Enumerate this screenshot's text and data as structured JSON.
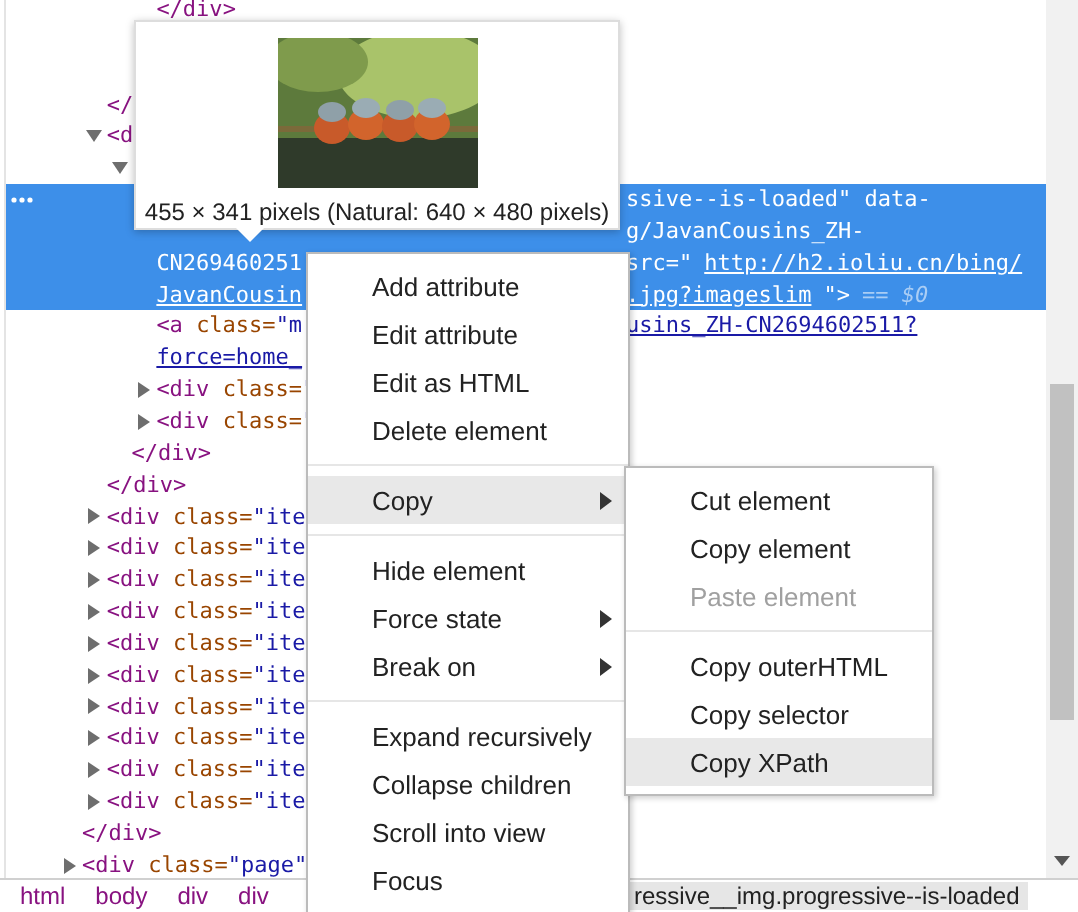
{
  "tree": [
    {
      "children": [
        {
          "children": [
            {
              "children": [
                {
                  "selected": false,
                  "rows": [
                    {
                      "text": [
                        {
                          "kind": "code",
                          "text": "</div>"
                        }
                      ]
                    }
                  ]
                }
              ]
            }
          ]
        },
        {
          "selected": false,
          "rows": [
            {
              "text": [
                {
                  "kind": "code",
                  "text": "</"
                }
              ]
            }
          ]
        },
        {
          "selected": false,
          "expanded": true,
          "rows": [
            {
              "text": [
                {
                  "kind": "code",
                  "text": "<d"
                }
              ]
            }
          ],
          "children": [
            {
              "selected": false,
              "expanded": true,
              "children": [
                {
                  "selected": true,
                  "rows": [
                    {
                      "tail": [
                        {
                          "kind": "code",
                          "text": "ssive--is-loaded\" data-"
                        }
                      ]
                    },
                    {
                      "tail": [
                        {
                          "kind": "code",
                          "text": "g/JavanCousins_ZH-"
                        }
                      ]
                    },
                    {
                      "text": [
                        {
                          "kind": "code",
                          "text": "CN269460251"
                        }
                      ],
                      "tail": [
                        {
                          "kind": "code",
                          "text": "src=\""
                        },
                        {
                          "kind": "link",
                          "text": "http://h2.ioliu.cn/bing/"
                        }
                      ]
                    },
                    {
                      "text": [
                        {
                          "kind": "link",
                          "text": "JavanCousin"
                        }
                      ],
                      "tail": [
                        {
                          "kind": "link",
                          "text": ".jpg?imageslim"
                        },
                        {
                          "kind": "code",
                          "text": "\">"
                        },
                        {
                          "kind": "muted",
                          "text": "== $0"
                        }
                      ]
                    }
                  ]
                },
                {
                  "selected": false,
                  "rows": [
                    {
                      "text": [
                        {
                          "kind": "code",
                          "text": "<a class=\"m"
                        }
                      ],
                      "tail": [
                        {
                          "kind": "link",
                          "text": "usins_ZH-CN2694602511?"
                        }
                      ]
                    },
                    {
                      "text": [
                        {
                          "kind": "link",
                          "text": "force=home_"
                        }
                      ]
                    }
                  ]
                },
                {
                  "selected": false,
                  "expanded": false,
                  "rows": [
                    {
                      "text": [
                        {
                          "kind": "code",
                          "text": "<div class=\""
                        }
                      ]
                    }
                  ]
                },
                {
                  "selected": false,
                  "expanded": false,
                  "rows": [
                    {
                      "text": [
                        {
                          "kind": "code",
                          "text": "<div class=\""
                        }
                      ]
                    }
                  ]
                }
              ]
            },
            {
              "selected": false,
              "rows": [
                {
                  "text": [
                    {
                      "kind": "code",
                      "text": "</div>"
                    }
                  ]
                }
              ]
            }
          ]
        },
        {
          "selected": false,
          "rows": [
            {
              "text": [
                {
                  "kind": "code",
                  "text": "</div>"
                }
              ]
            }
          ]
        },
        {
          "selected": false,
          "expanded": false,
          "rows": [
            {
              "text": [
                {
                  "kind": "code",
                  "text": "<div class=\"ite"
                }
              ]
            }
          ]
        },
        {
          "selected": false,
          "expanded": false,
          "rows": [
            {
              "text": [
                {
                  "kind": "code",
                  "text": "<div class=\"ite"
                }
              ]
            }
          ]
        },
        {
          "selected": false,
          "expanded": false,
          "rows": [
            {
              "text": [
                {
                  "kind": "code",
                  "text": "<div class=\"ite"
                }
              ]
            }
          ]
        },
        {
          "selected": false,
          "expanded": false,
          "rows": [
            {
              "text": [
                {
                  "kind": "code",
                  "text": "<div class=\"ite"
                }
              ]
            }
          ]
        },
        {
          "selected": false,
          "expanded": false,
          "rows": [
            {
              "text": [
                {
                  "kind": "code",
                  "text": "<div class=\"ite"
                }
              ]
            }
          ]
        },
        {
          "selected": false,
          "expanded": false,
          "rows": [
            {
              "text": [
                {
                  "kind": "code",
                  "text": "<div class=\"ite"
                }
              ]
            }
          ]
        },
        {
          "selected": false,
          "expanded": false,
          "rows": [
            {
              "text": [
                {
                  "kind": "code",
                  "text": "<div class=\"ite"
                }
              ]
            }
          ]
        },
        {
          "selected": false,
          "expanded": false,
          "rows": [
            {
              "text": [
                {
                  "kind": "code",
                  "text": "<div class=\"ite"
                }
              ]
            }
          ]
        },
        {
          "selected": false,
          "expanded": false,
          "rows": [
            {
              "text": [
                {
                  "kind": "code",
                  "text": "<div class=\"ite"
                }
              ]
            }
          ]
        },
        {
          "selected": false,
          "expanded": false,
          "rows": [
            {
              "text": [
                {
                  "kind": "code",
                  "text": "<div class=\"ite"
                }
              ]
            }
          ]
        }
      ]
    },
    {
      "selected": false,
      "rows": [
        {
          "text": [
            {
              "kind": "code",
              "text": "</div>"
            }
          ]
        }
      ]
    },
    {
      "selected": false,
      "expanded": false,
      "rows": [
        {
          "text": [
            {
              "kind": "code",
              "text": "<div class=\"page\""
            }
          ]
        }
      ]
    }
  ],
  "image_tooltip": {
    "caption": "455 × 341 pixels (Natural: 640 × 480 pixels)"
  },
  "context_menu": {
    "items": [
      {
        "kind": "item",
        "label": "Add attribute",
        "selected": false
      },
      {
        "kind": "item",
        "label": "Edit attribute",
        "selected": false
      },
      {
        "kind": "item",
        "label": "Edit as HTML",
        "selected": false
      },
      {
        "kind": "item",
        "label": "Delete element",
        "selected": false
      },
      {
        "kind": "separator"
      },
      {
        "kind": "item",
        "label": "Copy",
        "selected": true,
        "submenu": true,
        "expanded": true,
        "children": [
          {
            "kind": "item",
            "label": "Cut element",
            "selected": false,
            "disabled": false
          },
          {
            "kind": "item",
            "label": "Copy element",
            "selected": false,
            "disabled": false
          },
          {
            "kind": "item",
            "label": "Paste element",
            "selected": false,
            "disabled": true
          },
          {
            "kind": "separator"
          },
          {
            "kind": "item",
            "label": "Copy outerHTML",
            "selected": false,
            "disabled": false
          },
          {
            "kind": "item",
            "label": "Copy selector",
            "selected": false,
            "disabled": false
          },
          {
            "kind": "item",
            "label": "Copy XPath",
            "selected": true,
            "disabled": false
          }
        ]
      },
      {
        "kind": "separator"
      },
      {
        "kind": "item",
        "label": "Hide element",
        "selected": false
      },
      {
        "kind": "item",
        "label": "Force state",
        "selected": false,
        "submenu": true
      },
      {
        "kind": "item",
        "label": "Break on",
        "selected": false,
        "submenu": true
      },
      {
        "kind": "separator"
      },
      {
        "kind": "item",
        "label": "Expand recursively",
        "selected": false
      },
      {
        "kind": "item",
        "label": "Collapse children",
        "selected": false
      },
      {
        "kind": "item",
        "label": "Scroll into view",
        "selected": false
      },
      {
        "kind": "item",
        "label": "Focus",
        "selected": false
      }
    ]
  },
  "breadcrumbs": [
    {
      "label": "html",
      "selected": false
    },
    {
      "label": "body",
      "selected": false
    },
    {
      "label": "div",
      "selected": false
    },
    {
      "label": "div",
      "selected": false
    },
    {
      "label": "ressive__img.progressive--is-loaded",
      "selected": true
    }
  ]
}
